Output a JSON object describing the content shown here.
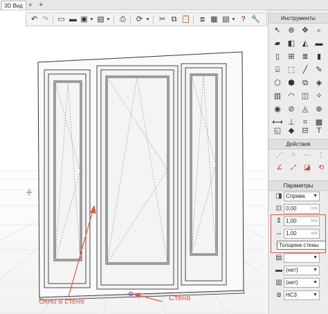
{
  "tabs": {
    "active": "3D Вид",
    "close": "×",
    "add": "+"
  },
  "annotations": {
    "window": "Окно в стене",
    "wall": "Стена"
  },
  "tools_section": {
    "title": "Инструменты"
  },
  "actions_section": {
    "title": "Действия"
  },
  "params_section": {
    "title": "Параметры",
    "side_value": "Справа",
    "rows": [
      {
        "value": "0,00",
        "unit": "мм"
      },
      {
        "value": "1,00",
        "unit": "мм"
      },
      {
        "value": "1,00",
        "unit": "мм"
      }
    ],
    "tooltip": "Толщина стены",
    "sel1": "(нет)",
    "sel2": "(нет)",
    "sel3": "НС3"
  },
  "colors": {
    "accent": "#e5553f",
    "highlight_box": "#e05050"
  }
}
